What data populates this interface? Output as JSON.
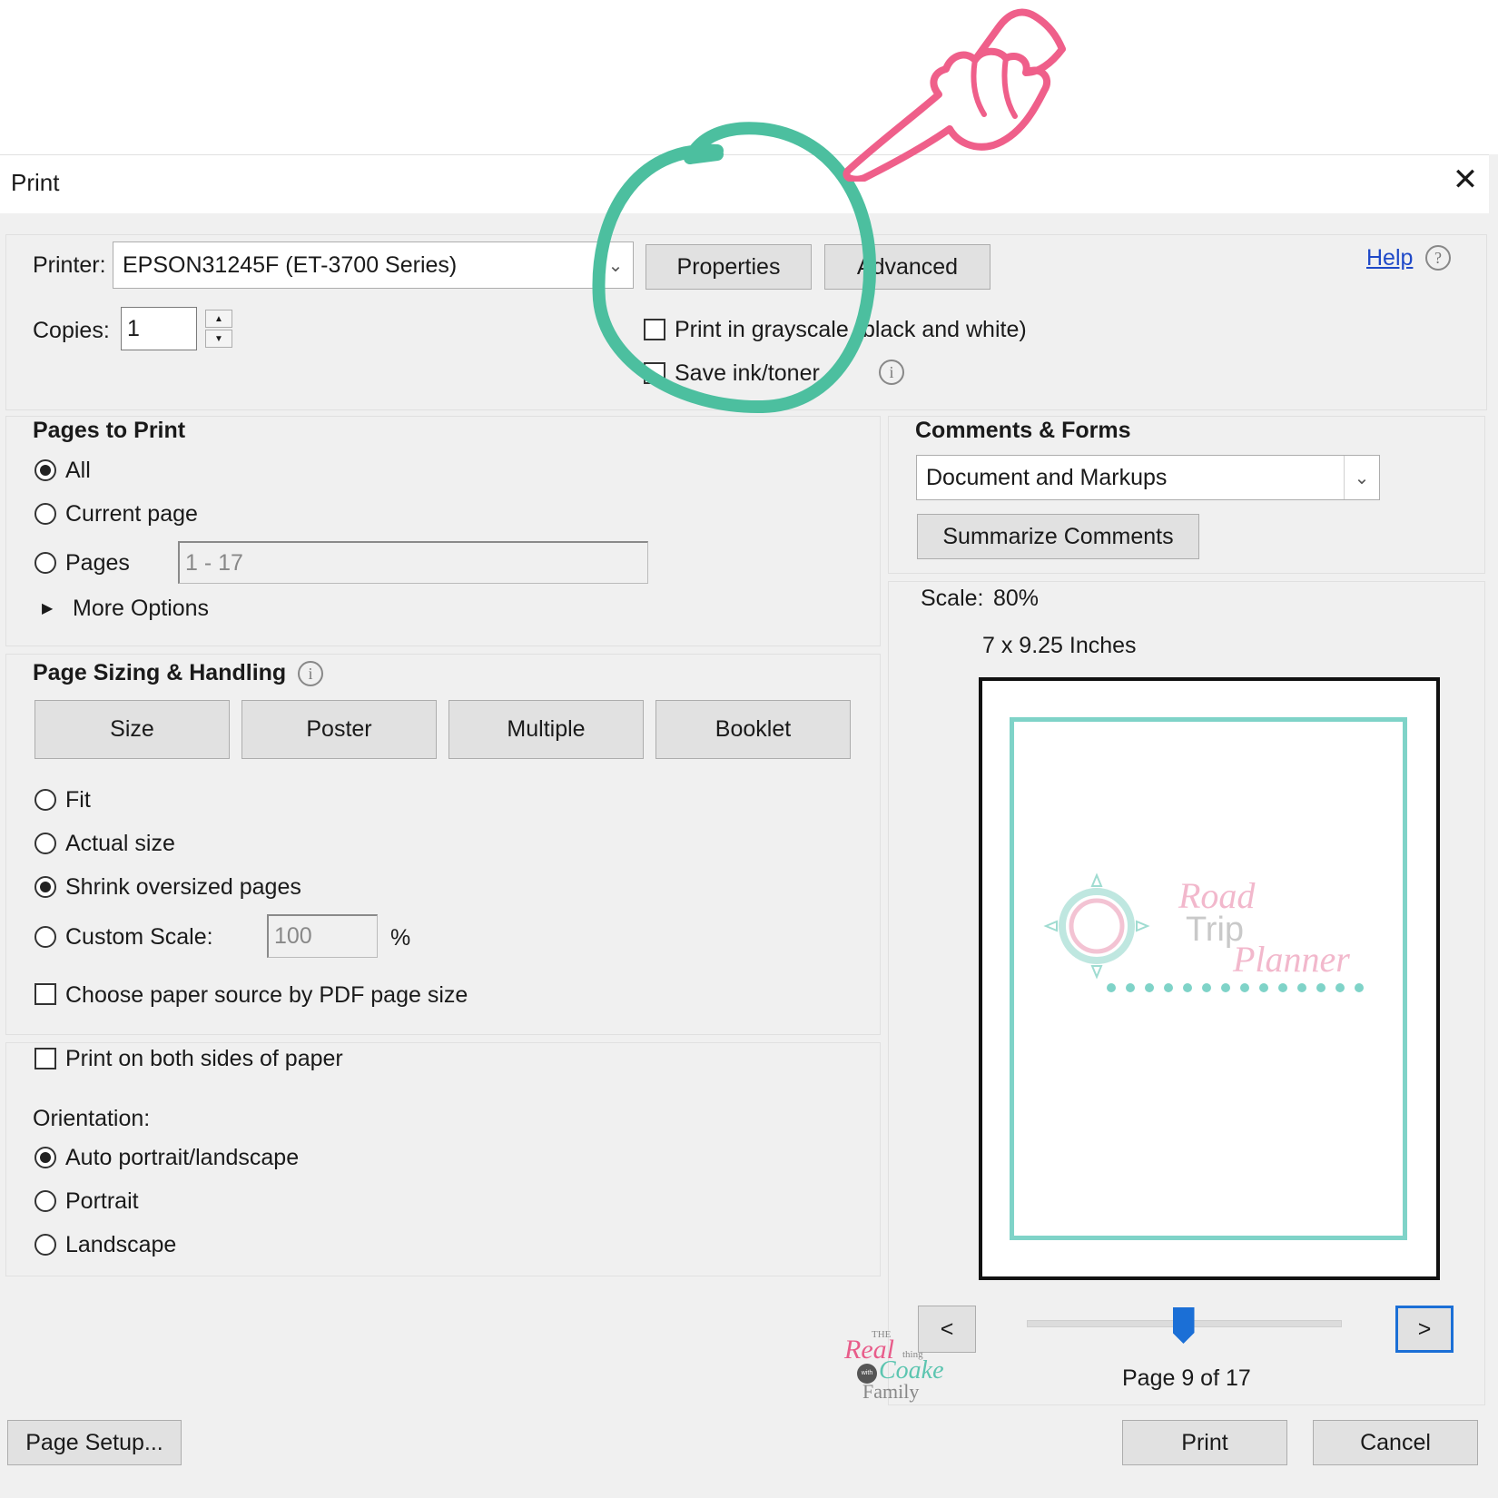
{
  "dialog": {
    "title": "Print",
    "close_glyph": "✕"
  },
  "printer": {
    "label": "Printer:",
    "value": "EPSON31245F (ET-3700 Series)",
    "properties_label": "Properties",
    "advanced_label": "Advanced",
    "help_label": "Help",
    "help_icon": "?"
  },
  "copies": {
    "label": "Copies:",
    "value": "1",
    "up": "▲",
    "down": "▼"
  },
  "options": {
    "grayscale_label": "Print in grayscale (black and white)",
    "save_ink_label": "Save ink/toner",
    "info_glyph": "i"
  },
  "pages_to_print": {
    "heading": "Pages to Print",
    "all_label": "All",
    "current_label": "Current page",
    "pages_label": "Pages",
    "pages_placeholder": "1 - 17",
    "more_options_label": "More Options",
    "more_options_glyph": "▶"
  },
  "page_sizing": {
    "heading": "Page Sizing & Handling",
    "tabs": [
      "Size",
      "Poster",
      "Multiple",
      "Booklet"
    ],
    "fit_label": "Fit",
    "actual_label": "Actual size",
    "shrink_label": "Shrink oversized pages",
    "custom_label": "Custom Scale:",
    "custom_value": "100",
    "percent": "%",
    "paper_source_label": "Choose paper source by PDF page size"
  },
  "duplex": {
    "label": "Print on both sides of paper"
  },
  "orientation": {
    "heading": "Orientation:",
    "auto_label": "Auto portrait/landscape",
    "portrait_label": "Portrait",
    "landscape_label": "Landscape"
  },
  "comments_forms": {
    "heading": "Comments & Forms",
    "value": "Document and Markups",
    "summarize_label": "Summarize Comments"
  },
  "preview": {
    "scale_label": "Scale:",
    "scale_value": "80%",
    "size_label": "7 x 9.25 Inches",
    "logo_line1": "Road",
    "logo_line2": "Trip",
    "logo_line3": "Planner",
    "prev_label": "<",
    "next_label": ">",
    "page_status": "Page 9 of 17",
    "slider_fraction": 0.5
  },
  "watermark": {
    "line1": "THE",
    "line2": "Real",
    "line3": "thing",
    "line4": "with the",
    "line5": "Coake",
    "line6": "Family"
  },
  "footer": {
    "page_setup_label": "Page Setup...",
    "print_label": "Print",
    "cancel_label": "Cancel"
  },
  "colors": {
    "annotation_circle": "#4cbf9f",
    "pointer_hand": "#ef5f8a",
    "link": "#1f49c8",
    "preview_border": "#7fd3c8"
  }
}
